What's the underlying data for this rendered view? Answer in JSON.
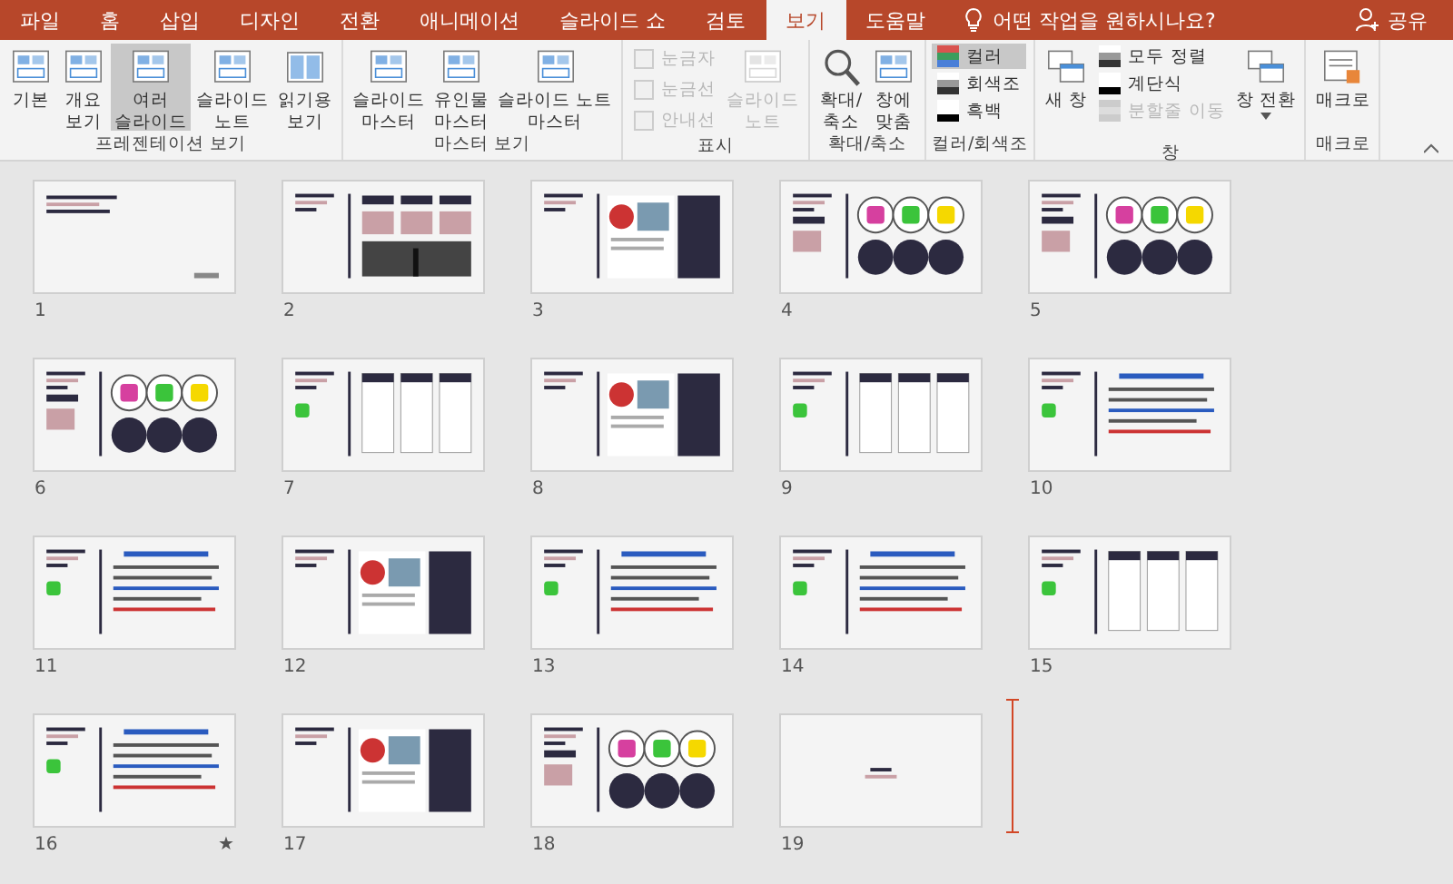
{
  "tabs": [
    {
      "label": "파일",
      "selected": false
    },
    {
      "label": "홈",
      "selected": false
    },
    {
      "label": "삽입",
      "selected": false
    },
    {
      "label": "디자인",
      "selected": false
    },
    {
      "label": "전환",
      "selected": false
    },
    {
      "label": "애니메이션",
      "selected": false
    },
    {
      "label": "슬라이드 쇼",
      "selected": false
    },
    {
      "label": "검토",
      "selected": false
    },
    {
      "label": "보기",
      "selected": true
    },
    {
      "label": "도움말",
      "selected": false
    }
  ],
  "tell_me": {
    "placeholder": "어떤 작업을 원하시나요?"
  },
  "share": {
    "label": "공유"
  },
  "groups": [
    {
      "label": "프레젠테이션 보기",
      "items": [
        {
          "kind": "large",
          "label": "기본",
          "selected": false,
          "disabled": false
        },
        {
          "kind": "large",
          "label": "개요\n보기",
          "selected": false,
          "disabled": false
        },
        {
          "kind": "large",
          "label": "여러\n슬라이드",
          "selected": true,
          "disabled": false
        },
        {
          "kind": "large",
          "label": "슬라이드\n노트",
          "selected": false,
          "disabled": false
        },
        {
          "kind": "large",
          "label": "읽기용\n보기",
          "selected": false,
          "disabled": false
        }
      ]
    },
    {
      "label": "마스터 보기",
      "items": [
        {
          "kind": "large",
          "label": "슬라이드\n마스터",
          "selected": false,
          "disabled": false
        },
        {
          "kind": "large",
          "label": "유인물\n마스터",
          "selected": false,
          "disabled": false
        },
        {
          "kind": "large",
          "label": "슬라이드 노트\n마스터",
          "selected": false,
          "disabled": false
        }
      ]
    },
    {
      "label": "표시",
      "items": [
        {
          "kind": "checkbox",
          "label": "눈금자",
          "checked": false,
          "disabled": true
        },
        {
          "kind": "checkbox",
          "label": "눈금선",
          "checked": false,
          "disabled": true
        },
        {
          "kind": "checkbox",
          "label": "안내선",
          "checked": false,
          "disabled": true
        },
        {
          "kind": "large",
          "label": "슬라이드\n노트",
          "selected": false,
          "disabled": true
        }
      ]
    },
    {
      "label": "확대/축소",
      "items": [
        {
          "kind": "large",
          "label": "확대/\n축소",
          "selected": false,
          "disabled": false
        },
        {
          "kind": "large",
          "label": "창에\n맞춤",
          "selected": false,
          "disabled": false
        }
      ]
    },
    {
      "label": "컬러/회색조",
      "items": [
        {
          "kind": "small",
          "label": "컬러",
          "selected": true,
          "disabled": false
        },
        {
          "kind": "small",
          "label": "회색조",
          "selected": false,
          "disabled": false
        },
        {
          "kind": "small",
          "label": "흑백",
          "selected": false,
          "disabled": false
        }
      ]
    },
    {
      "label": "창",
      "items": [
        {
          "kind": "large",
          "label": "새 창",
          "selected": false,
          "disabled": false
        },
        {
          "kind": "small",
          "label": "모두 정렬",
          "selected": false,
          "disabled": false
        },
        {
          "kind": "small",
          "label": "계단식",
          "selected": false,
          "disabled": false
        },
        {
          "kind": "small",
          "label": "분할줄 이동",
          "selected": false,
          "disabled": true
        },
        {
          "kind": "large",
          "label": "창 전환",
          "selected": false,
          "disabled": false
        }
      ]
    },
    {
      "label": "매크로",
      "items": [
        {
          "kind": "large",
          "label": "매크로",
          "selected": false,
          "disabled": false
        }
      ]
    }
  ],
  "slides": [
    {
      "number": "1",
      "kind": "title"
    },
    {
      "number": "2",
      "kind": "boxes"
    },
    {
      "number": "3",
      "kind": "photos"
    },
    {
      "number": "4",
      "kind": "circles"
    },
    {
      "number": "5",
      "kind": "circles"
    },
    {
      "number": "6",
      "kind": "circles"
    },
    {
      "number": "7",
      "kind": "cards"
    },
    {
      "number": "8",
      "kind": "photos"
    },
    {
      "number": "9",
      "kind": "cards"
    },
    {
      "number": "10",
      "kind": "text"
    },
    {
      "number": "11",
      "kind": "text"
    },
    {
      "number": "12",
      "kind": "photos"
    },
    {
      "number": "13",
      "kind": "text"
    },
    {
      "number": "14",
      "kind": "text"
    },
    {
      "number": "15",
      "kind": "cards"
    },
    {
      "number": "16",
      "kind": "text",
      "marker": "★"
    },
    {
      "number": "17",
      "kind": "photos"
    },
    {
      "number": "18",
      "kind": "circles"
    },
    {
      "number": "19",
      "kind": "end"
    }
  ]
}
